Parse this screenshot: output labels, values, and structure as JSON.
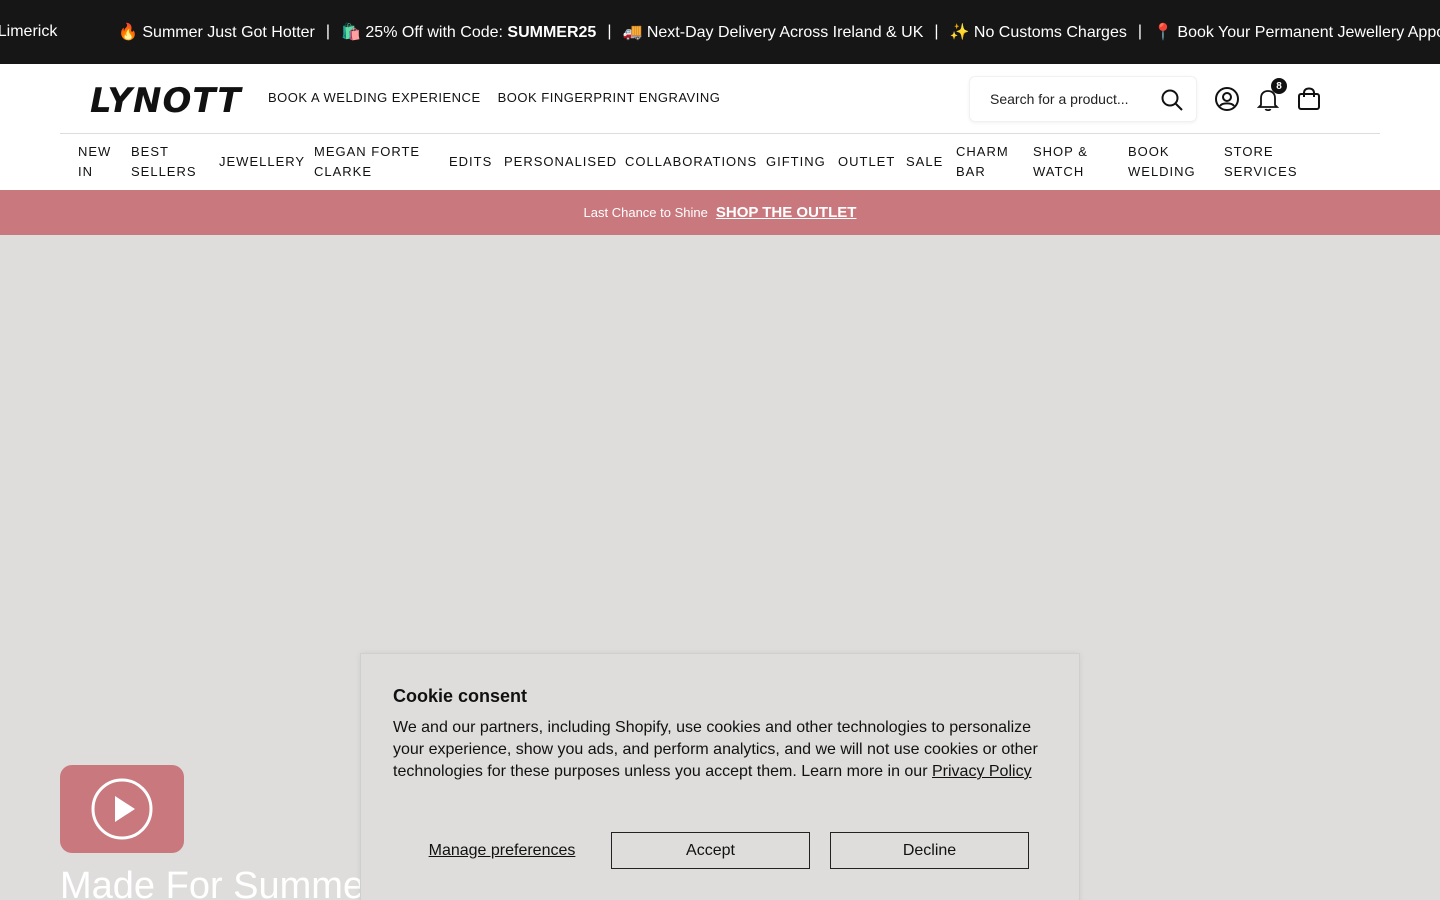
{
  "announcement": {
    "first_fragment": "r Limerick",
    "items": [
      {
        "icon": "🔥",
        "text": "Summer Just Got Hotter"
      },
      {
        "icon": "🛍️",
        "text": "25% Off with Code: ",
        "strong": "SUMMER25"
      },
      {
        "icon": "🚚",
        "text": "Next-Day Delivery Across Ireland & UK"
      },
      {
        "icon": "✨",
        "text": "No Customs Charges"
      },
      {
        "icon": "📍",
        "text": "Book Your Permanent Jewellery Appointm"
      }
    ],
    "separator": "|"
  },
  "header": {
    "logo": "LYNOTT",
    "top_links": [
      "BOOK A WELDING EXPERIENCE",
      "BOOK FINGERPRINT ENGRAVING"
    ],
    "search_placeholder": "Search for a product...",
    "notification_count": "8"
  },
  "nav": {
    "items": [
      {
        "line1": "NEW",
        "line2": "IN"
      },
      {
        "line1": "BEST",
        "line2": "SELLERS"
      },
      {
        "line1": "JEWELLERY",
        "line2": ""
      },
      {
        "line1": "MEGAN FORTE",
        "line2": "CLARKE"
      },
      {
        "line1": "EDITS",
        "line2": ""
      },
      {
        "line1": "PERSONALISED",
        "line2": ""
      },
      {
        "line1": "COLLABORATIONS",
        "line2": ""
      },
      {
        "line1": "GIFTING",
        "line2": ""
      },
      {
        "line1": "OUTLET",
        "line2": ""
      },
      {
        "line1": "SALE",
        "line2": ""
      },
      {
        "line1": "CHARM",
        "line2": "BAR"
      },
      {
        "line1": "SHOP &",
        "line2": "WATCH"
      },
      {
        "line1": "BOOK",
        "line2": "WELDING"
      },
      {
        "line1": "STORE",
        "line2": "SERVICES"
      }
    ]
  },
  "promo": {
    "text": "Last Chance to Shine",
    "link": "SHOP THE OUTLET"
  },
  "hero": {
    "title": "Made For Summer"
  },
  "cookie": {
    "title": "Cookie consent",
    "body": "We and our partners, including Shopify, use cookies and other technologies to personalize your experience, show you ads, and perform analytics, and we will not use cookies or other technologies for these purposes unless you accept them. Learn more in our ",
    "policy_link": "Privacy Policy",
    "manage": "Manage preferences",
    "accept": "Accept",
    "decline": "Decline"
  },
  "colors": {
    "announcement_bg": "#161616",
    "promo_bg": "#c9787e",
    "hero_bg": "#dedddb"
  }
}
